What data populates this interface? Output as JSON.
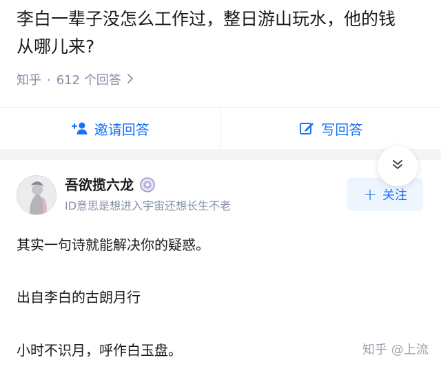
{
  "question": {
    "title": "李白一辈子没怎么工作过，整日游山玩水，他的钱从哪儿来?",
    "site": "知乎",
    "separator": "·",
    "answer_count": "612 个回答",
    "chevron_icon": "chevron-right-icon"
  },
  "actions": {
    "invite_label": "邀请回答",
    "invite_icon": "invite-user-icon",
    "write_label": "写回答",
    "write_icon": "edit-icon"
  },
  "collapse_icon": "double-chevron-down-icon",
  "answer": {
    "author_name": "吾欲揽六龙",
    "author_bio": "ID意思是想进入宇宙还想长生不老",
    "badge_icon": "medal-badge-icon",
    "follow_label": "关注",
    "paragraphs": [
      "其实一句诗就能解决你的疑惑。",
      "出自李白的古朗月行",
      "小时不识月，呼作白玉盘。"
    ],
    "watermark": "知乎 @上流"
  },
  "colors": {
    "accent": "#1772f6",
    "muted": "#8590a6",
    "text": "#1a1a1a",
    "band": "#f4f5f7",
    "follow_bg": "#eef5ff"
  }
}
